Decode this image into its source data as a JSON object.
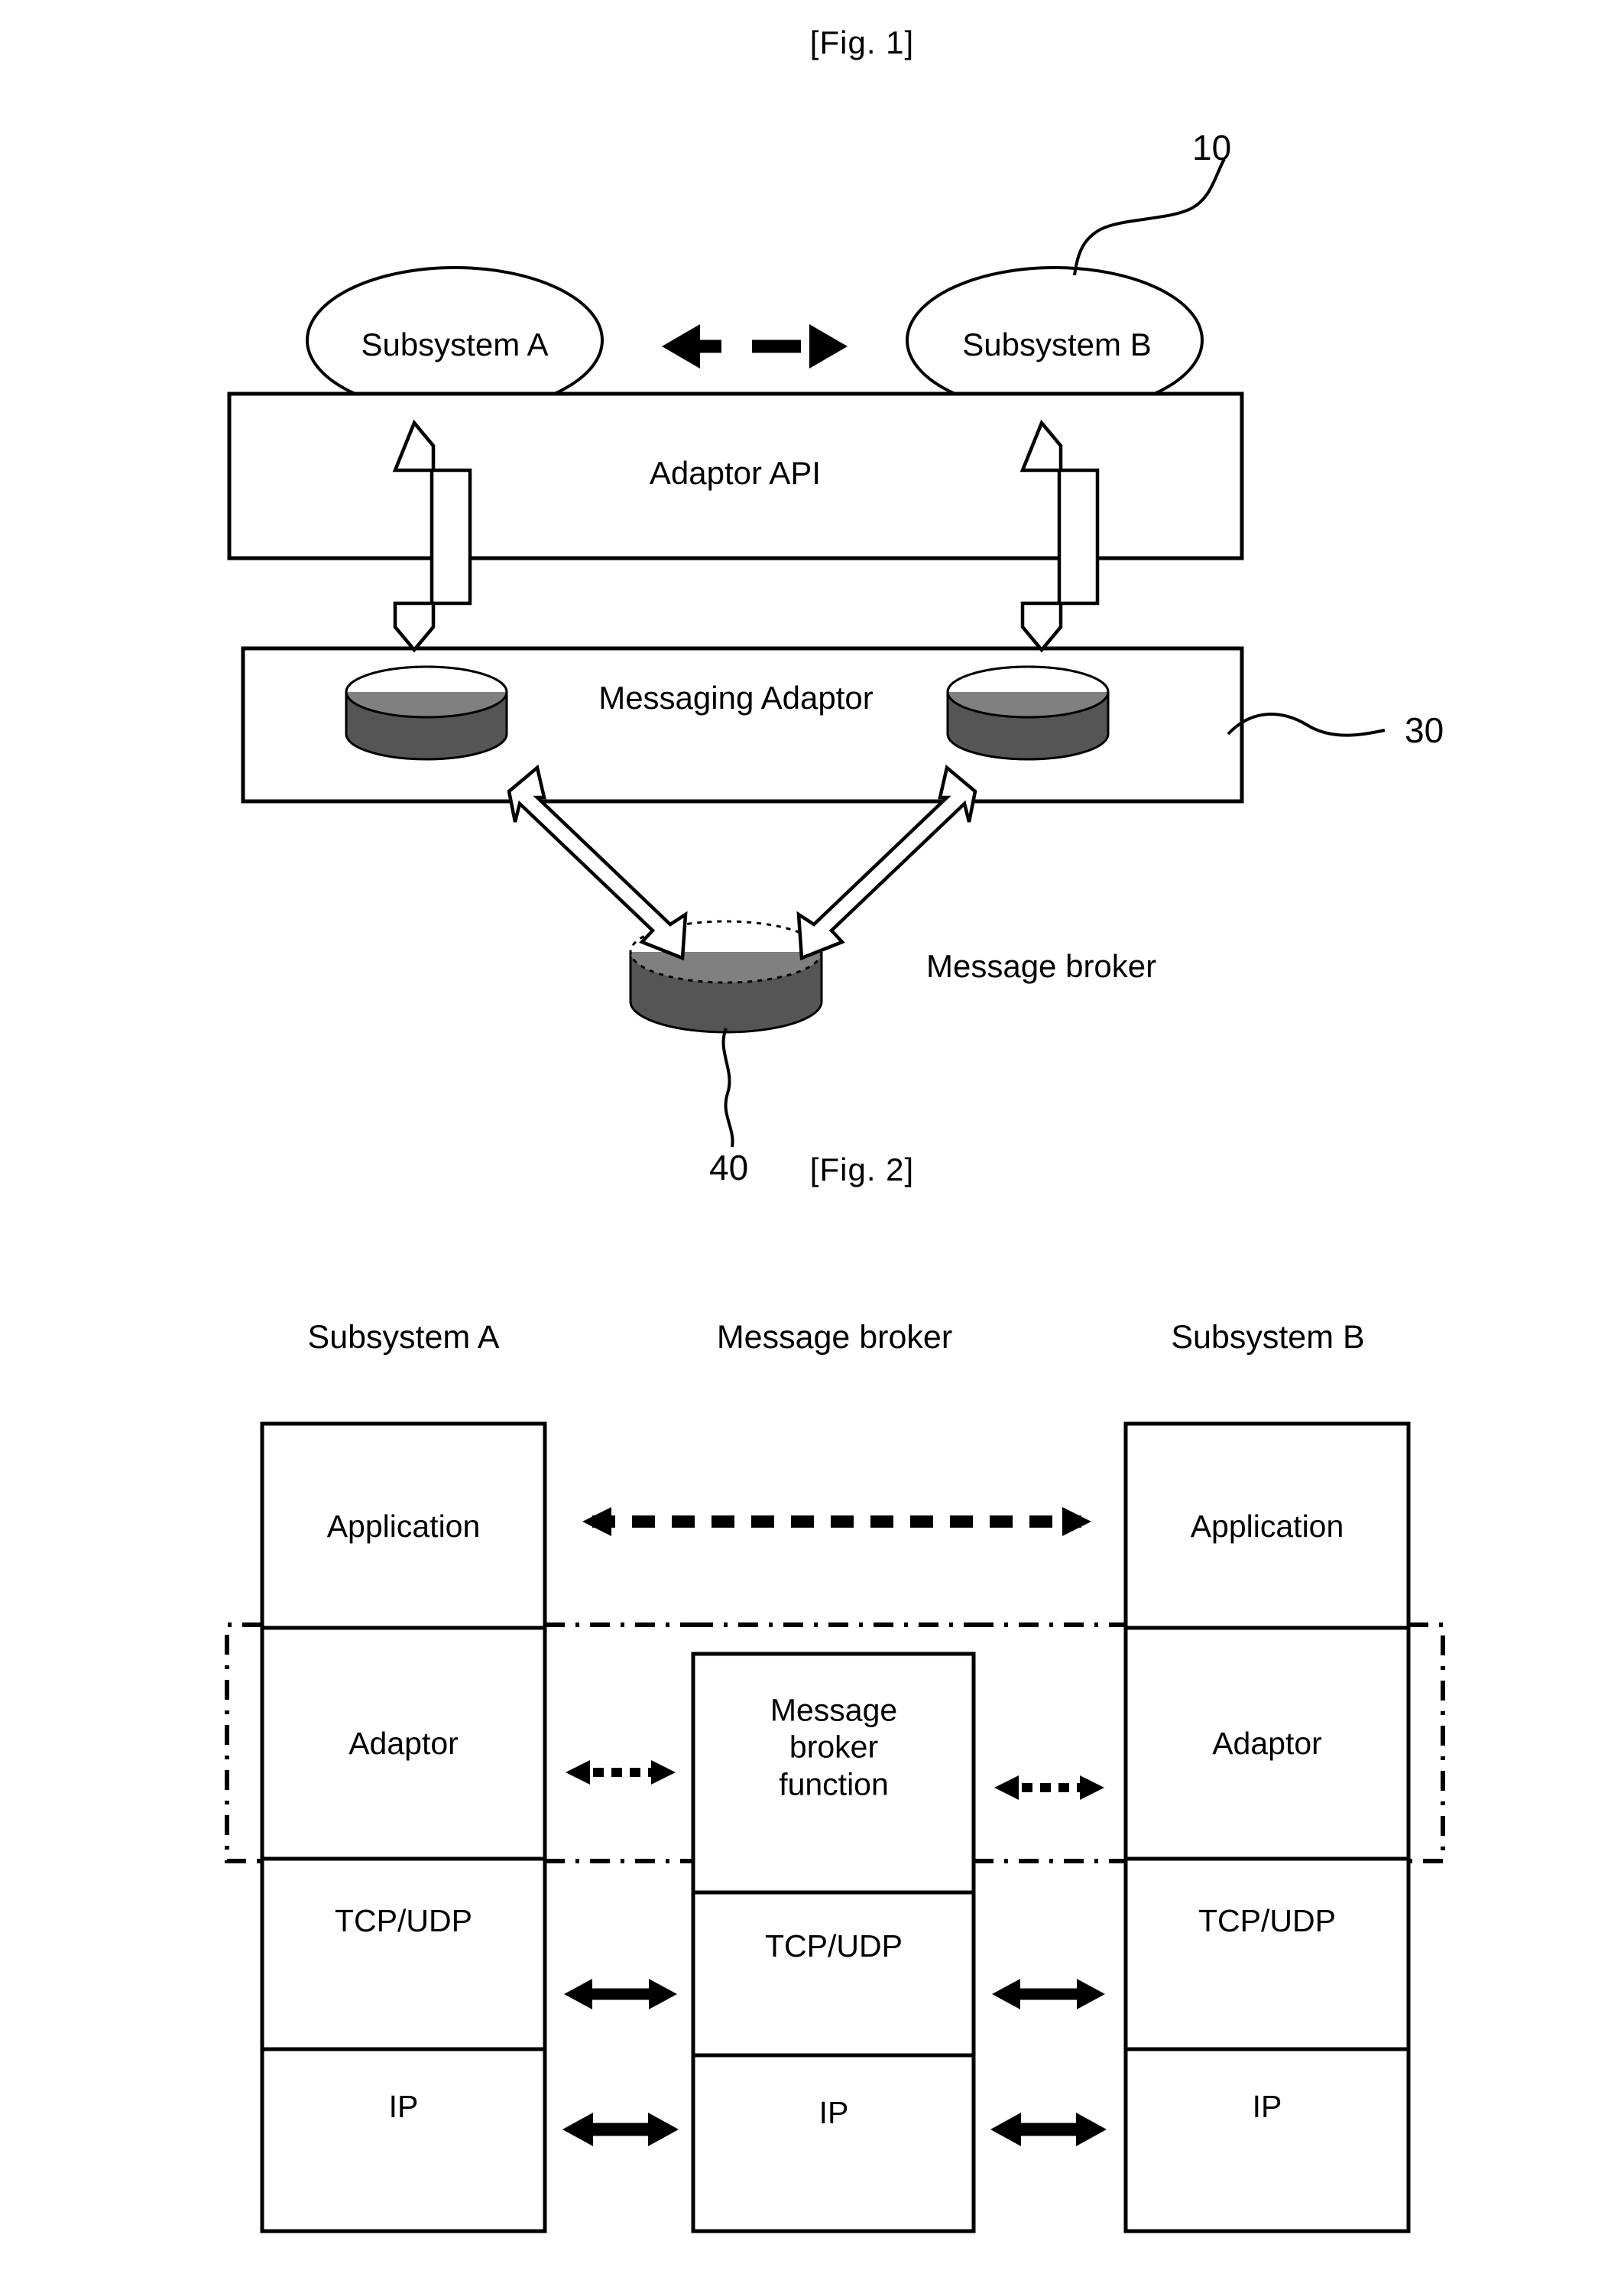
{
  "figures": [
    {
      "caption": "[Fig. 1]",
      "ref_numbers": {
        "subsystems": "10",
        "messaging_adaptor": "30",
        "message_broker": "40"
      },
      "nodes": {
        "subsystem_a": "Subsystem A",
        "subsystem_b": "Subsystem B",
        "adaptor_api": "Adaptor API",
        "messaging_adaptor": "Messaging Adaptor",
        "message_broker": "Message broker"
      }
    },
    {
      "caption": "[Fig. 2]",
      "headers": [
        "Subsystem A",
        "Message broker",
        "Subsystem B"
      ],
      "columns": [
        {
          "name": "Subsystem A",
          "layers": [
            "Application",
            "Adaptor",
            "TCP/UDP",
            "IP"
          ]
        },
        {
          "name": "Message broker",
          "layers": [
            "Message broker function",
            "TCP/UDP",
            "IP"
          ]
        },
        {
          "name": "Subsystem B",
          "layers": [
            "Application",
            "Adaptor",
            "TCP/UDP",
            "IP"
          ]
        }
      ],
      "middle_layer_lines": [
        "Message",
        "broker",
        "function"
      ]
    }
  ],
  "colors": {
    "ink": "#000000",
    "paper": "#ffffff"
  }
}
